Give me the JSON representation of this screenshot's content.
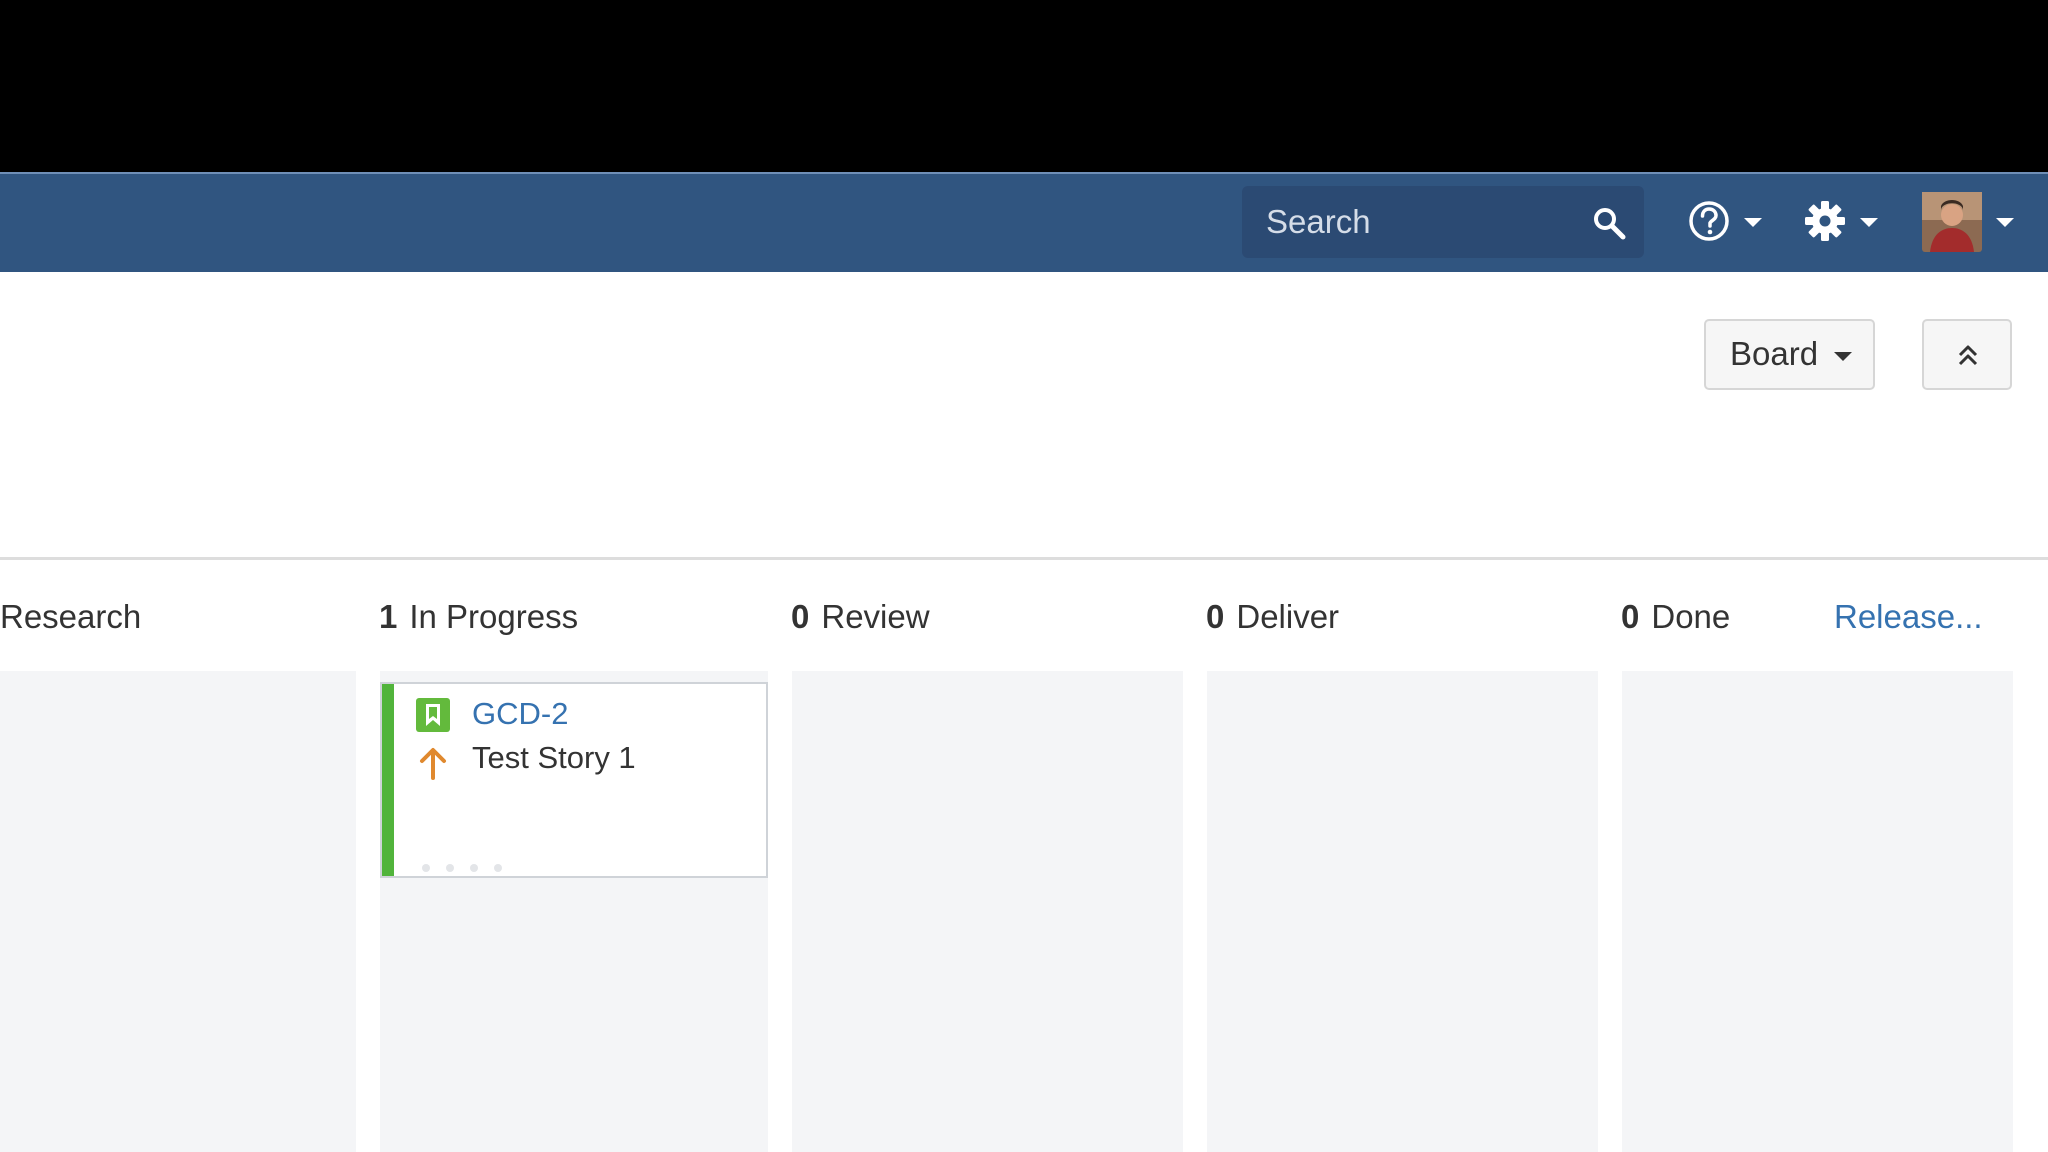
{
  "colors": {
    "navbar": "#305580",
    "link": "#3572b0",
    "story_green": "#51b43b",
    "priority_orange": "#e0892e",
    "column_bg": "#f4f5f7"
  },
  "header": {
    "search": {
      "placeholder": "Search",
      "icon": "search-icon"
    },
    "help": {
      "icon": "help-icon"
    },
    "settings": {
      "icon": "gear-icon"
    },
    "profile": {
      "icon": "avatar"
    }
  },
  "toolbar": {
    "board_label": "Board",
    "collapse_icon": "double-chevron-up-icon"
  },
  "columns": [
    {
      "count": "",
      "name": "Research"
    },
    {
      "count": "1",
      "name": "In Progress"
    },
    {
      "count": "0",
      "name": "Review"
    },
    {
      "count": "0",
      "name": "Deliver"
    },
    {
      "count": "0",
      "name": "Done"
    }
  ],
  "release_link": "Release...",
  "cards": [
    {
      "key": "GCD-2",
      "summary": "Test Story 1",
      "type_icon": "story-icon",
      "priority_icon": "priority-up-arrow-icon"
    }
  ]
}
